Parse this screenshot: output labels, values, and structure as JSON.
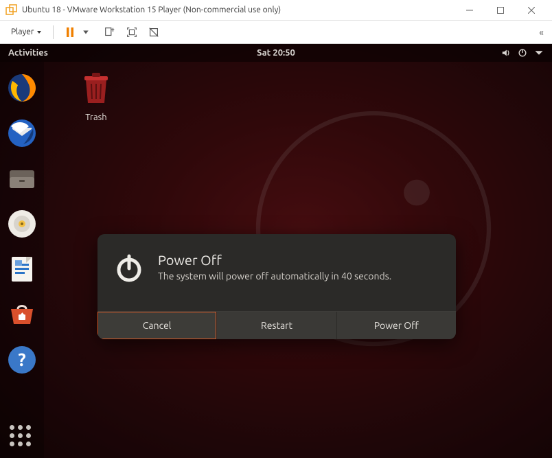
{
  "window": {
    "title": "Ubuntu 18 - VMware Workstation 15 Player (Non-commercial use only)"
  },
  "vmtoolbar": {
    "player_label": "Player"
  },
  "gnome": {
    "activities": "Activities",
    "clock": "Sat 20:50"
  },
  "desktop": {
    "trash_label": "Trash"
  },
  "dialog": {
    "title": "Power Off",
    "message": "The system will power off automatically in 40 seconds.",
    "cancel": "Cancel",
    "restart": "Restart",
    "poweroff": "Power Off"
  }
}
